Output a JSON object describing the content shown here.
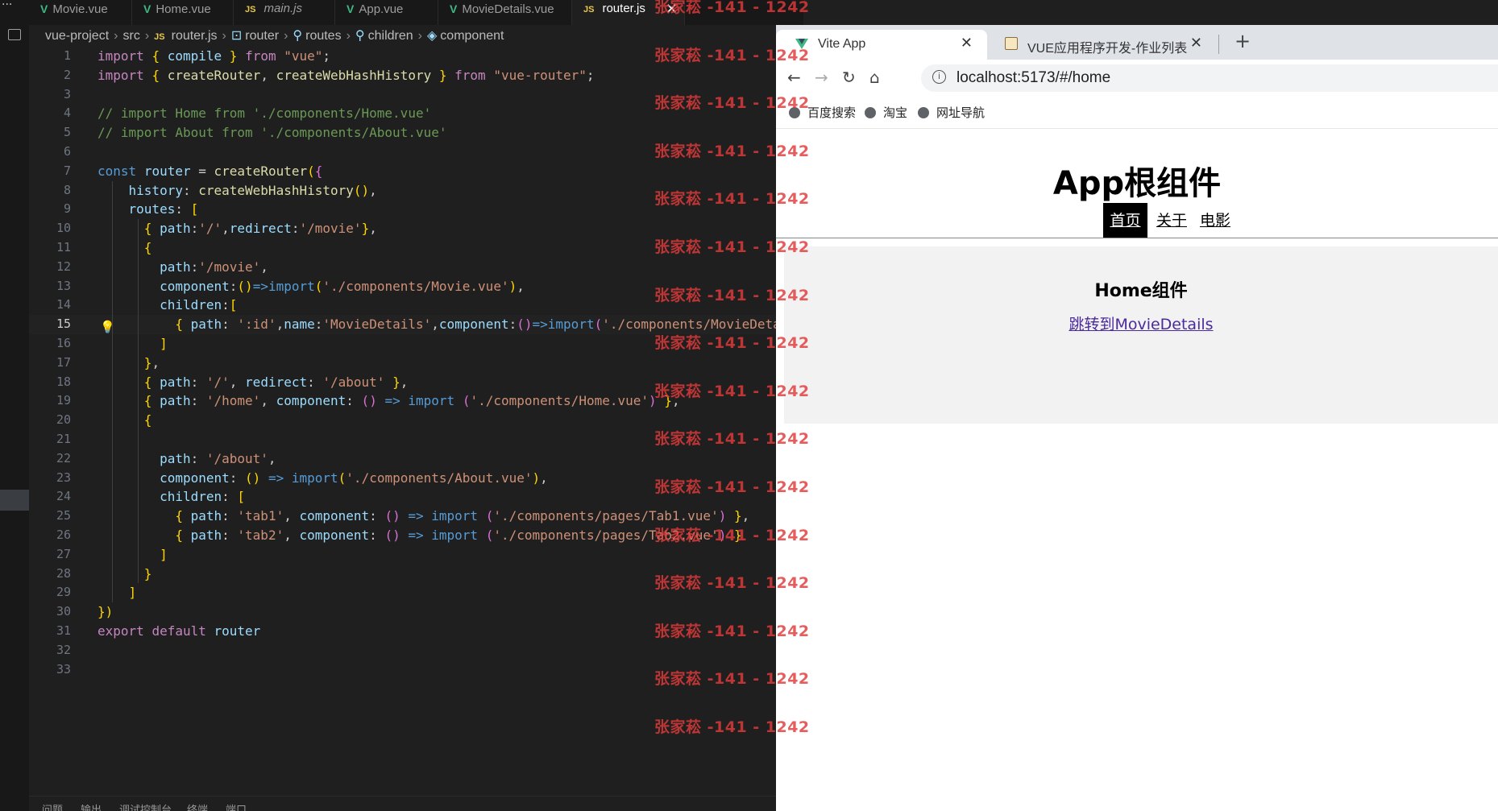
{
  "editor": {
    "tabs": [
      {
        "label": "Movie.vue",
        "type": "vue"
      },
      {
        "label": "Home.vue",
        "type": "vue"
      },
      {
        "label": "main.js",
        "type": "js"
      },
      {
        "label": "App.vue",
        "type": "vue"
      },
      {
        "label": "MovieDetails.vue",
        "type": "vue"
      },
      {
        "label": "router.js",
        "type": "js",
        "active": true
      }
    ],
    "icons": {
      "vue": "V",
      "js": "JS",
      "close": "✕",
      "more": "···"
    },
    "breadcrumb": [
      "vue-project",
      "src",
      "router.js",
      "router",
      "routes",
      "children",
      "component"
    ],
    "current_line": 15,
    "lines": [
      {
        "n": "1",
        "code": "import { compile } from \"vue\";"
      },
      {
        "n": "2",
        "code": "import { createRouter, createWebHashHistory } from \"vue-router\";"
      },
      {
        "n": "3",
        "code": ""
      },
      {
        "n": "4",
        "code": "// import Home from './components/Home.vue'"
      },
      {
        "n": "5",
        "code": "// import About from './components/About.vue'"
      },
      {
        "n": "6",
        "code": ""
      },
      {
        "n": "7",
        "code": "const router = createRouter({"
      },
      {
        "n": "8",
        "code": "    history: createWebHashHistory(),"
      },
      {
        "n": "9",
        "code": "    routes: ["
      },
      {
        "n": "10",
        "code": "      { path:'/',redirect:'/movie'},"
      },
      {
        "n": "11",
        "code": "      {"
      },
      {
        "n": "12",
        "code": "        path:'/movie',"
      },
      {
        "n": "13",
        "code": "        component:()=>import('./components/Movie.vue'),"
      },
      {
        "n": "14",
        "code": "        children:["
      },
      {
        "n": "15",
        "code": "          { path: ':id',name:'MovieDetails',component:()=>import('./components/MovieDetails"
      },
      {
        "n": "16",
        "code": "        ]"
      },
      {
        "n": "17",
        "code": "      },"
      },
      {
        "n": "18",
        "code": "      { path: '/', redirect: '/about' },"
      },
      {
        "n": "19",
        "code": "      { path: '/home', component: () => import ('./components/Home.vue') },"
      },
      {
        "n": "20",
        "code": "      {"
      },
      {
        "n": "21",
        "code": ""
      },
      {
        "n": "22",
        "code": "        path: '/about',"
      },
      {
        "n": "23",
        "code": "        component: () => import('./components/About.vue'),"
      },
      {
        "n": "24",
        "code": "        children: ["
      },
      {
        "n": "25",
        "code": "          { path: 'tab1', component: () => import ('./components/pages/Tab1.vue') },"
      },
      {
        "n": "26",
        "code": "          { path: 'tab2', component: () => import ('./components/pages/Tab2.vue') }"
      },
      {
        "n": "27",
        "code": "        ]"
      },
      {
        "n": "28",
        "code": "      }"
      },
      {
        "n": "29",
        "code": "    ]"
      },
      {
        "n": "30",
        "code": "})"
      },
      {
        "n": "31",
        "code": "export default router"
      },
      {
        "n": "32",
        "code": ""
      },
      {
        "n": "33",
        "code": ""
      }
    ],
    "panel_tabs": [
      "问题",
      "输出",
      "调试控制台",
      "终端",
      "端口"
    ]
  },
  "watermark": {
    "text": "张家菘 -141 - 1242",
    "color": "#e03a3a",
    "count": 16
  },
  "browser": {
    "tabs": [
      {
        "label": "Vite App",
        "active": true,
        "icon": "vue-logo-icon"
      },
      {
        "label": "VUE应用程序开发-作业列表",
        "active": false,
        "icon": "image-icon"
      }
    ],
    "new_tab": "+",
    "tab_close": "✕",
    "nav": {
      "back": "←",
      "forward": "→",
      "reload": "↻",
      "home": "⌂"
    },
    "url": "localhost:5173/#/home",
    "info_icon": "i",
    "bookmarks": [
      "百度搜索",
      "淘宝",
      "网址导航"
    ],
    "page": {
      "title": "App根组件",
      "nav_links": [
        {
          "label": "首页",
          "active": true
        },
        {
          "label": "关于",
          "active": false
        },
        {
          "label": "电影",
          "active": false
        }
      ],
      "home_heading": "Home组件",
      "home_link": "跳转到MovieDetails"
    }
  }
}
